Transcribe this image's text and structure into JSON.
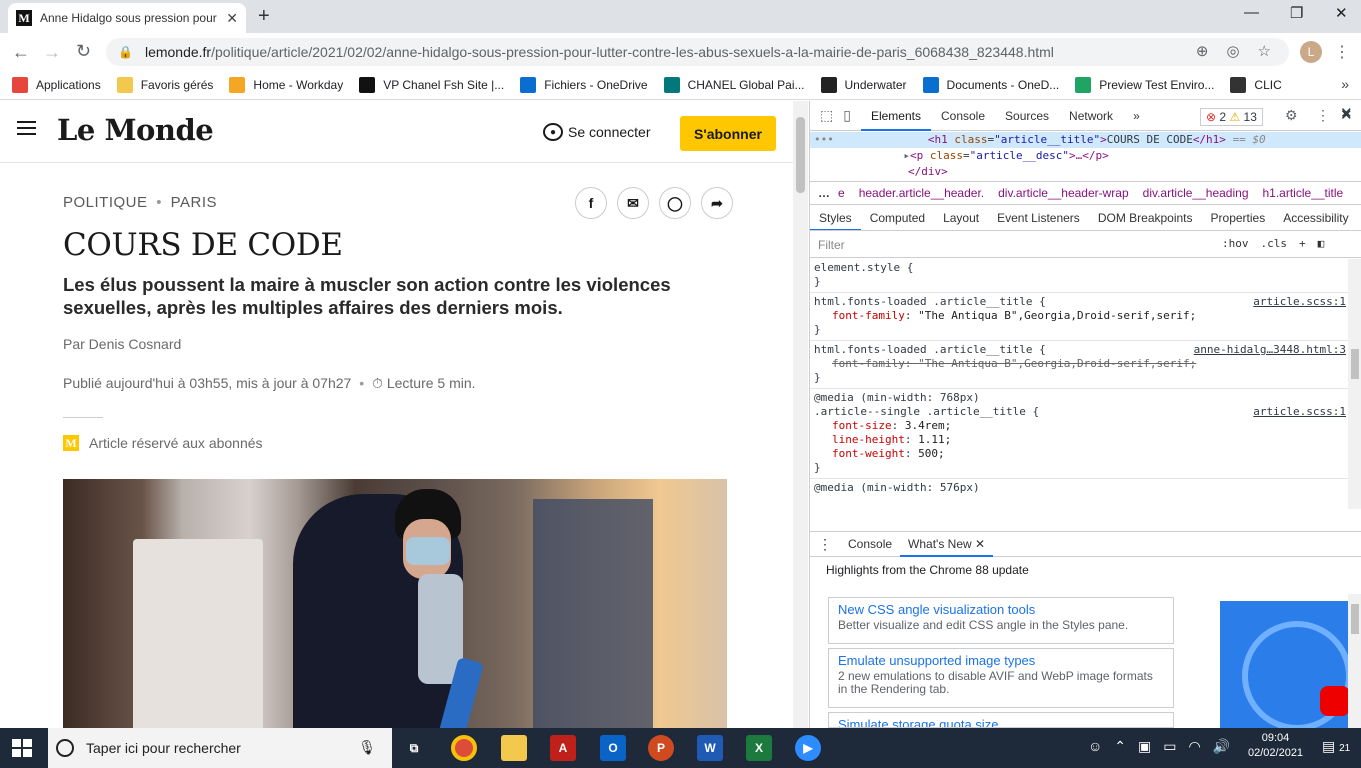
{
  "browser": {
    "tab_title": "Anne Hidalgo sous pression pour",
    "tab_favicon": "M",
    "new_tab": "+",
    "url_host": "lemonde.fr",
    "url_path": "/politique/article/2021/02/02/anne-hidalgo-sous-pression-pour-lutter-contre-les-abus-sexuels-a-la-mairie-de-paris_6068438_823448.html",
    "avatar_letter": "L",
    "bookmarks": [
      {
        "label": "Applications",
        "icon": "apps-grid-icon",
        "color": "#e8453c"
      },
      {
        "label": "Favoris gérés",
        "icon": "folder-icon",
        "color": "#f2c94c"
      },
      {
        "label": "Home - Workday",
        "icon": "workday-icon",
        "color": "#f5a623"
      },
      {
        "label": "VP Chanel Fsh Site |...",
        "icon": "chanel-icon",
        "color": "#111111"
      },
      {
        "label": "Fichiers - OneDrive",
        "icon": "onedrive-icon",
        "color": "#0a6ed1"
      },
      {
        "label": "CHANEL Global Pai...",
        "icon": "sharepoint-icon",
        "color": "#03787c"
      },
      {
        "label": "Underwater",
        "icon": "plus-box-icon",
        "color": "#222222"
      },
      {
        "label": "Documents - OneD...",
        "icon": "onedrive-icon",
        "color": "#0a6ed1"
      },
      {
        "label": "Preview Test Enviro...",
        "icon": "sheets-icon",
        "color": "#1fa463"
      },
      {
        "label": "CLIC",
        "icon": "clic-icon",
        "color": "#333333"
      }
    ]
  },
  "page": {
    "logo": "Le Monde",
    "connect_label": "Se connecter",
    "subscribe_label": "S'abonner",
    "brand_yellow": "#ffc700",
    "breadcrumb_1": "POLITIQUE",
    "breadcrumb_sep": "•",
    "breadcrumb_2": "PARIS",
    "title": "COURS DE CODE",
    "description": "Les élus poussent la maire à muscler son action contre les violences sexuelles, après les multiples affaires des derniers mois.",
    "author": "Par Denis Cosnard",
    "published": "Publié aujourd'hui à 03h55, mis à jour à 07h27",
    "pub_sep": "•",
    "reading_time": "Lecture 5 min.",
    "reserved": "Article réservé aux abonnés",
    "share_icons": [
      "facebook-icon",
      "email-icon",
      "whatsapp-icon",
      "share-icon"
    ]
  },
  "devtools": {
    "tabs": [
      "Elements",
      "Console",
      "Sources",
      "Network"
    ],
    "more": "»",
    "errors": "2",
    "warnings": "13",
    "dom_selected": {
      "tag_open": "<h1",
      "attr": "class",
      "val": "\"article__title\"",
      "text": "COURS DE CODE",
      "tag_close": "</h1>",
      "eq": "== $0"
    },
    "dom_line2": {
      "tag": "<p",
      "attr": "class",
      "val": "\"article__desc\"",
      "rest": "…</p>"
    },
    "dom_line3": "</div>",
    "crumbs": [
      "e",
      "header.article__header.",
      "div.article__header-wrap",
      "div.article__heading",
      "h1.article__title"
    ],
    "style_tabs": [
      "Styles",
      "Computed",
      "Layout",
      "Event Listeners",
      "DOM Breakpoints",
      "Properties",
      "Accessibility"
    ],
    "filter_placeholder": "Filter",
    "filter_hov": ":hov",
    "filter_cls": ".cls",
    "rules": {
      "r1_sel": "element.style {",
      "r1_close": "}",
      "r2_sel": "html.fonts-loaded .article__title {",
      "r2_src": "article.scss:1",
      "r2_prop": "font-family",
      "r2_val": "\"The Antiqua B\",Georgia,Droid-serif,serif;",
      "r3_sel": "html.fonts-loaded .article__title {",
      "r3_src": "anne-hidalg…3448.html:3",
      "r3_prop": "font-family",
      "r3_val": "\"The Antiqua B\",Georgia,Droid-serif,serif;",
      "r4_media": "@media (min-width: 768px)",
      "r4_sel": ".article--single .article__title {",
      "r4_src": "article.scss:1",
      "r4_p1": "font-size",
      "r4_v1": "3.4rem;",
      "r4_p2": "line-height",
      "r4_v2": "1.11;",
      "r4_p3": "font-weight",
      "r4_v3": "500;",
      "r5_media": "@media (min-width: 576px)"
    },
    "drawer_tabs": [
      "Console",
      "What's New"
    ],
    "whats_new_head": "Highlights from the Chrome 88 update",
    "cards": [
      {
        "title": "New CSS angle visualization tools",
        "desc": "Better visualize and edit CSS angle in the Styles pane."
      },
      {
        "title": "Emulate unsupported image types",
        "desc": "2 new emulations to disable AVIF and WebP image formats in the Rendering tab."
      },
      {
        "title": "Simulate storage quota size",
        "desc": ""
      }
    ]
  },
  "taskbar": {
    "search_placeholder": "Taper ici pour rechercher",
    "apps": [
      "task-view-icon",
      "chrome-icon",
      "explorer-icon",
      "acrobat-icon",
      "outlook-icon",
      "powerpoint-icon",
      "word-icon",
      "excel-icon",
      "zoom-icon"
    ],
    "time": "09:04",
    "date": "02/02/2021",
    "notifications": "21"
  }
}
